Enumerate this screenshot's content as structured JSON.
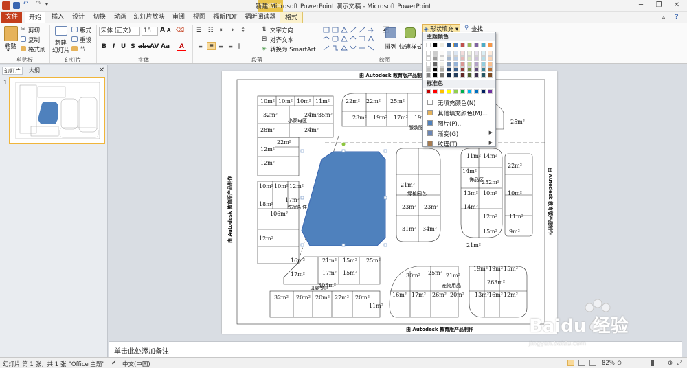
{
  "window": {
    "title": "新建 Microsoft PowerPoint 演示文稿 - Microsoft PowerPoint",
    "context_tab_group": "绘图工具"
  },
  "tabs": [
    "文件",
    "开始",
    "插入",
    "设计",
    "切换",
    "动画",
    "幻灯片放映",
    "审阅",
    "视图",
    "福昕PDF",
    "福昕阅读器",
    "格式"
  ],
  "ribbon": {
    "clipboard": {
      "paste": "粘贴",
      "cut": "剪切",
      "copy": "复制",
      "format_painter": "格式刷",
      "group": "剪贴板"
    },
    "slides": {
      "new_slide": "新建",
      "new_slide2": "幻灯片",
      "layout": "版式",
      "reset": "重设",
      "section": "节",
      "group": "幻灯片"
    },
    "font": {
      "font_name": "宋体 (正文)",
      "font_size": "18",
      "group": "字体"
    },
    "paragraph": {
      "text_direction": "文字方向",
      "align_text": "对齐文本",
      "smartart": "转换为 SmartArt",
      "group": "段落"
    },
    "drawing": {
      "arrange": "排列",
      "quick_styles": "快速样式",
      "shape_fill": "形状填充",
      "find": "查找",
      "group": "绘图"
    }
  },
  "left_panel": {
    "tab_slides": "幻灯片",
    "tab_outline": "大纲",
    "slide_number": "1"
  },
  "slide": {
    "header": "由 Autodesk 教育版产品制作",
    "side_left": "由 Autodesk 教育版产品制作",
    "side_right": "由 Autodesk 教育版产品制作",
    "footer": "由 Autodesk 教育版产品制作",
    "shape_color": "#4f81bd",
    "labels": [
      "10m²",
      "10m²",
      "10m²",
      "11m²",
      "32m²",
      "24m²",
      "35m²",
      "22m²",
      "22m²",
      "25m²",
      "28m²",
      "24m²",
      "23m²",
      "19m²",
      "17m²",
      "19m²",
      "25m²",
      "12m²",
      "22m²",
      "12m²",
      "11m²",
      "14m²",
      "22m²",
      "10m²",
      "10m²",
      "12m²",
      "14m²",
      "21m²",
      "252m²",
      "18m²",
      "17m²",
      "106m²",
      "13m²",
      "10m²",
      "10m²",
      "23m²",
      "23m²",
      "14m²",
      "12m²",
      "11m²",
      "12m²",
      "31m²",
      "34m²",
      "15m²",
      "9m²",
      "21m²",
      "16m²",
      "21m²",
      "15m²",
      "25m²",
      "30m²",
      "25m²",
      "21m²",
      "19m²",
      "19m²",
      "15m²",
      "17m²",
      "17m²",
      "15m²",
      "263m²",
      "32m²",
      "20m²",
      "20m²",
      "27m²",
      "20m²",
      "16m²",
      "17m²",
      "26m²",
      "20m²",
      "13m²",
      "16m²",
      "12m²",
      "11m²",
      "303m²"
    ],
    "area_labels": [
      "饰品区",
      "母婴专区",
      "小家电区",
      "宠物用品",
      "绿植园艺",
      "饰品配件",
      "服装配件"
    ]
  },
  "color_dropdown": {
    "theme_heading": "主题颜色",
    "standard_heading": "标准色",
    "theme_colors": [
      "#ffffff",
      "#000000",
      "#eeece1",
      "#1f497d",
      "#4f81bd",
      "#c0504d",
      "#9bbb59",
      "#8064a2",
      "#4bacc6",
      "#f79646"
    ],
    "standard_colors": [
      "#c00000",
      "#ff0000",
      "#ffc000",
      "#ffff00",
      "#92d050",
      "#00b050",
      "#00b0f0",
      "#0070c0",
      "#002060",
      "#7030a0"
    ],
    "items": [
      {
        "label": "无填充颜色(N)",
        "icon": "no-fill-icon",
        "has_arrow": false
      },
      {
        "label": "其他填充颜色(M)...",
        "icon": "palette-icon",
        "has_arrow": false
      },
      {
        "label": "图片(P)...",
        "icon": "picture-icon",
        "has_arrow": false
      },
      {
        "label": "渐变(G)",
        "icon": "gradient-icon",
        "has_arrow": true
      },
      {
        "label": "纹理(T)",
        "icon": "texture-icon",
        "has_arrow": true
      }
    ]
  },
  "notes": {
    "placeholder": "单击此处添加备注"
  },
  "status_bar": {
    "slide_info": "幻灯片 第 1 张，共 1 张",
    "theme": "\"Office 主题\"",
    "language": "中文(中国)",
    "zoom": "82%"
  },
  "watermark": {
    "brand": "Baidu 经验",
    "url": "jingyan.baidu.com"
  }
}
